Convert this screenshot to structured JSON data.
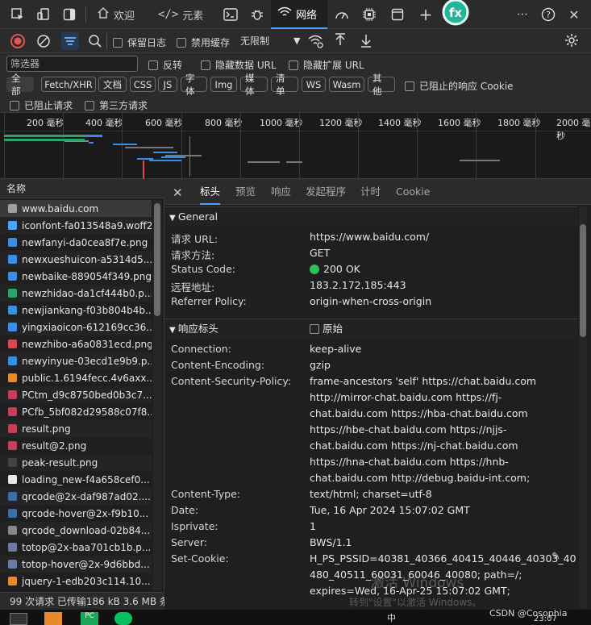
{
  "topbar": {
    "tabs": [
      {
        "label": "欢迎",
        "icon": "home-icon"
      },
      {
        "label": "元素",
        "icon": "code-icon"
      },
      {
        "label": "网络",
        "icon": "wifi-icon"
      }
    ]
  },
  "toolbar": {
    "preserve_log": "保留日志",
    "disable_cache": "禁用缓存",
    "throttle": "无限制"
  },
  "filter": {
    "placeholder": "筛选器",
    "invert": "反转",
    "hide_data_urls": "隐藏数据 URL",
    "hide_ext_urls": "隐藏扩展 URL"
  },
  "types": [
    "全部",
    "Fetch/XHR",
    "文档",
    "CSS",
    "JS",
    "字体",
    "Img",
    "媒体",
    "清单",
    "WS",
    "Wasm",
    "其他"
  ],
  "blocked_response_cookies": "已阻止的响应 Cookie",
  "blocked_requests": "已阻止请求",
  "third_party": "第三方请求",
  "timeline": {
    "ticks": [
      "200 毫秒",
      "400 毫秒",
      "600 毫秒",
      "800 毫秒",
      "1000 毫秒",
      "1200 毫秒",
      "1400 毫秒",
      "1600 毫秒",
      "1800 毫秒",
      "2000 毫秒"
    ]
  },
  "requests": {
    "header": "名称",
    "items": [
      {
        "name": "www.baidu.com",
        "color": "#9aa0a6"
      },
      {
        "name": "iconfont-fa013548a9.woff2",
        "color": "#4aa3ff"
      },
      {
        "name": "newfanyi-da0cea8f7e.png",
        "color": "#3b8ee8"
      },
      {
        "name": "newxueshuicon-a5314d5...",
        "color": "#3b8ee8"
      },
      {
        "name": "newbaike-889054f349.png",
        "color": "#3b8ee8"
      },
      {
        "name": "newzhidao-da1cf444b0.p...",
        "color": "#2ea36b"
      },
      {
        "name": "newjiankang-f03b804b4b...",
        "color": "#3b8ee8"
      },
      {
        "name": "yingxiaoicon-612169cc36...",
        "color": "#3b8ee8"
      },
      {
        "name": "newzhibo-a6a0831ecd.png",
        "color": "#e0474c"
      },
      {
        "name": "newyinyue-03ecd1e9b9.p...",
        "color": "#3b8ee8"
      },
      {
        "name": "public.1.6194fecc.4v6axx...",
        "color": "#e88a2a"
      },
      {
        "name": "PCtm_d9c8750bed0b3c7...",
        "color": "#c2405a"
      },
      {
        "name": "PCfb_5bf082d29588c07f8...",
        "color": "#c2405a"
      },
      {
        "name": "result.png",
        "color": "#c2405a"
      },
      {
        "name": "result@2.png",
        "color": "#c2405a"
      },
      {
        "name": "peak-result.png",
        "color": "#444"
      },
      {
        "name": "loading_new-f4a658cef0...",
        "color": "#e6e6e6"
      },
      {
        "name": "qrcode@2x-daf987ad02....",
        "color": "#3b6ea8"
      },
      {
        "name": "qrcode-hover@2x-f9b10...",
        "color": "#3b6ea8"
      },
      {
        "name": "qrcode_download-02b84...",
        "color": "#888"
      },
      {
        "name": "totop@2x-baa701cb1b.p...",
        "color": "#6b7aa8"
      },
      {
        "name": "totop-hover@2x-9d6bbd...",
        "color": "#6b7aa8"
      },
      {
        "name": "jquery-1-edb203c114.10....",
        "color": "#e88a2a"
      }
    ]
  },
  "status": "99 次请求  已传输186 kB  3.6 MB 条",
  "detail": {
    "tabs": [
      "标头",
      "预览",
      "响应",
      "发起程序",
      "计时",
      "Cookie"
    ],
    "general_title": "General",
    "general": [
      {
        "k": "请求 URL:",
        "v": "https://www.baidu.com/"
      },
      {
        "k": "请求方法:",
        "v": "GET"
      },
      {
        "k": "Status Code:",
        "v": "200 OK"
      },
      {
        "k": "远程地址:",
        "v": "183.2.172.185:443"
      },
      {
        "k": "Referrer Policy:",
        "v": "origin-when-cross-origin"
      }
    ],
    "response_title": "响应标头",
    "raw_label": "原始",
    "response": [
      {
        "k": "Connection:",
        "v": [
          "keep-alive"
        ]
      },
      {
        "k": "Content-Encoding:",
        "v": [
          "gzip"
        ]
      },
      {
        "k": "Content-Security-Policy:",
        "v": [
          "frame-ancestors 'self' https://chat.baidu.com",
          "http://mirror-chat.baidu.com https://fj-",
          "chat.baidu.com https://hba-chat.baidu.com",
          "https://hbe-chat.baidu.com https://njjs-",
          "chat.baidu.com https://nj-chat.baidu.com",
          "https://hna-chat.baidu.com https://hnb-",
          "chat.baidu.com http://debug.baidu-int.com;"
        ]
      },
      {
        "k": "Content-Type:",
        "v": [
          "text/html; charset=utf-8"
        ]
      },
      {
        "k": "Date:",
        "v": [
          "Tue, 16 Apr 2024 15:07:02 GMT"
        ]
      },
      {
        "k": "Isprivate:",
        "v": [
          "1"
        ]
      },
      {
        "k": "Server:",
        "v": [
          "BWS/1.1"
        ]
      },
      {
        "k": "Set-Cookie:",
        "v": [
          "H_PS_PSSID=40381_40366_40415_40446_40303_40",
          "480_40511_60031_60046_40080; path=/;",
          "expires=Wed, 16-Apr-25 15:07:02 GMT;"
        ]
      }
    ]
  },
  "watermark": {
    "line1": "激活 Windows",
    "line2": "转到\"设置\"以激活 Windows。"
  },
  "taskbar": {
    "time": "23:07",
    "csdn": "CSDN @Cosophia"
  }
}
